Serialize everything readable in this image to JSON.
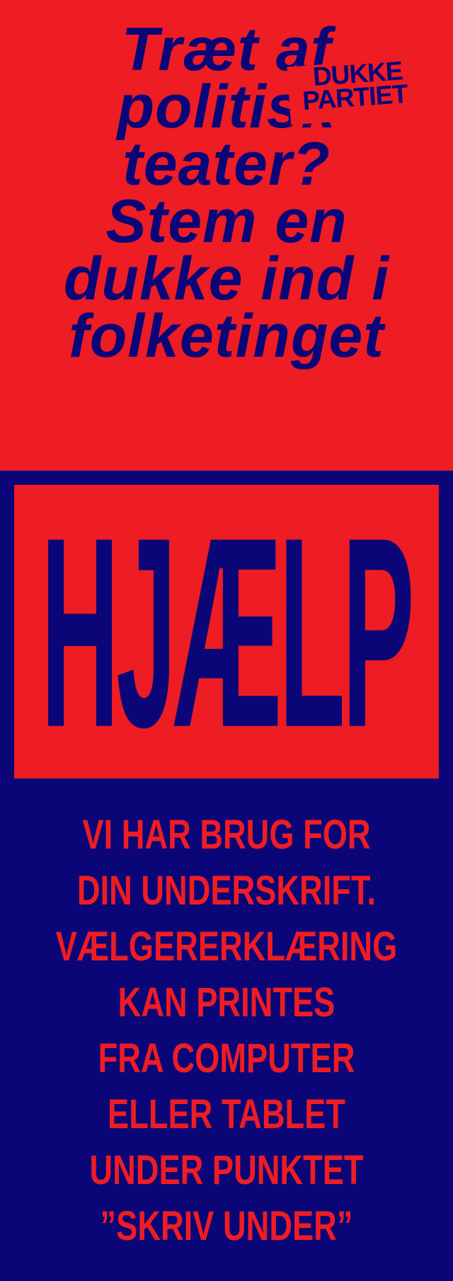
{
  "poster": {
    "headline_lines": [
      "Træt af",
      "politisk",
      "teater?",
      "Stem en",
      "dukke ind i",
      "folketinget"
    ],
    "logo": {
      "line1": "DUKKE",
      "line2": "PARTIET"
    },
    "help_word": "HJÆLP",
    "body_lines": [
      "VI HAR BRUG FOR",
      "DIN UNDERSKRIFT.",
      "VÆLGERERKLÆRING",
      "KAN PRINTES",
      "FRA COMPUTER",
      "ELLER TABLET",
      "UNDER PUNKTET",
      "”SKRIV UNDER”"
    ],
    "colors": {
      "red": "#ee1c23",
      "navy": "#0a0678"
    }
  }
}
